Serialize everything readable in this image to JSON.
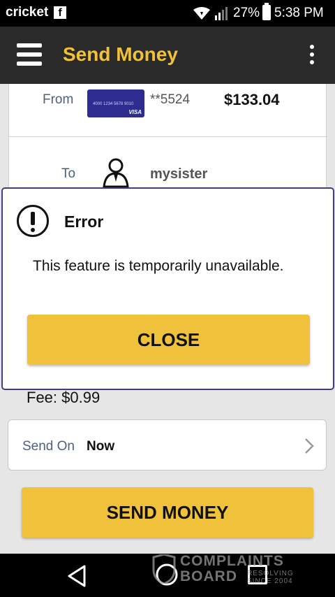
{
  "status_bar": {
    "carrier": "cricket",
    "fb_glyph": "f",
    "battery": "27%",
    "time": "5:38 PM"
  },
  "header": {
    "title": "Send Money",
    "menu_icon": "hamburger-menu-icon",
    "overflow_icon": "more-vert-icon"
  },
  "transfer": {
    "from_label": "From",
    "card_masked": "**5524",
    "card_thumb_number": "4000 1234 5678 9010",
    "card_thumb_brand": "VISA",
    "balance": "$133.04",
    "to_label": "To",
    "recipient": "mysister"
  },
  "fee": "Fee: $0.99",
  "send_on": {
    "label": "Send On",
    "value": "Now"
  },
  "send_button": "SEND MONEY",
  "dialog": {
    "title": "Error",
    "message": "This feature is temporarily unavailable.",
    "close_label": "CLOSE"
  },
  "watermark": {
    "line1": "COMPLAINTS",
    "line2": "BOARD",
    "sub": "RESOLVING SINCE 2004"
  },
  "colors": {
    "accent": "#f0c23c",
    "header_bg": "#2a2a2a",
    "label_blue": "#4d6280",
    "dialog_border": "#4a3a7a"
  }
}
